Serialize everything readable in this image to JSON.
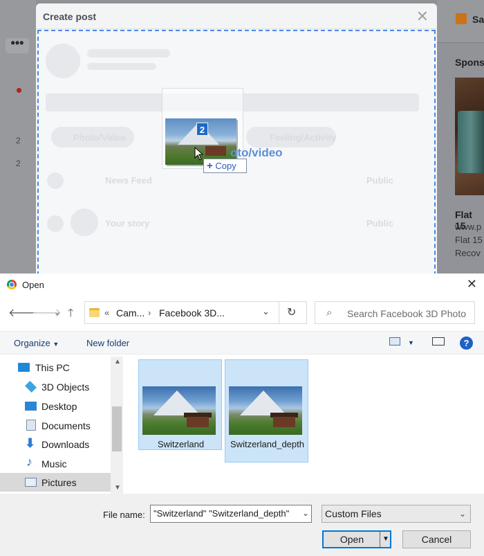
{
  "facebook": {
    "menu_dots": "•••",
    "left_counts": [
      "2",
      "2"
    ],
    "gift_label": "Sa",
    "sponsored_label": "Spons",
    "ad_title": "Flat 15",
    "ad_lines": [
      "www.p",
      "Flat 15",
      "Recov"
    ]
  },
  "create_post": {
    "title": "Create post",
    "close_icon": "✕",
    "drop_label": "oto/video",
    "ghost_labels": [
      "Photo/Video",
      "Feeling/Activity",
      "News Feed",
      "Public",
      "Your story",
      "Public"
    ]
  },
  "drag": {
    "count": "2",
    "copy_label": "Copy"
  },
  "open_dialog": {
    "title": "Open",
    "close_icon": "✕",
    "breadcrumb": [
      "Cam...",
      "Facebook 3D..."
    ],
    "breadcrumb_prefix": "«",
    "search_placeholder": "Search Facebook 3D Photo",
    "toolbar": {
      "organize": "Organize",
      "new_folder": "New folder",
      "help": "?"
    },
    "nav_items": [
      {
        "label": "This PC",
        "icon": "computer-icon",
        "color": "#1e88d8"
      },
      {
        "label": "3D Objects",
        "icon": "cube-icon",
        "color": "#3aa5e0"
      },
      {
        "label": "Desktop",
        "icon": "desktop-icon",
        "color": "#2a86d4"
      },
      {
        "label": "Documents",
        "icon": "documents-icon",
        "color": "#7b8fa6"
      },
      {
        "label": "Downloads",
        "icon": "download-icon",
        "color": "#2f7bd6"
      },
      {
        "label": "Music",
        "icon": "music-icon",
        "color": "#2a6fc9"
      },
      {
        "label": "Pictures",
        "icon": "pictures-icon",
        "color": "#6b86a8",
        "selected": true
      }
    ],
    "files": [
      {
        "name": "Switzerland"
      },
      {
        "name": "Switzerland_depth"
      }
    ],
    "file_name_label": "File name:",
    "file_name_value": "\"Switzerland\" \"Switzerland_depth\"",
    "file_type": "Custom Files",
    "open_button": "Open",
    "cancel_button": "Cancel"
  },
  "colors": {
    "accent": "#0078d7",
    "selection": "#cce4f8",
    "dropzone_border": "#4a86e8"
  }
}
